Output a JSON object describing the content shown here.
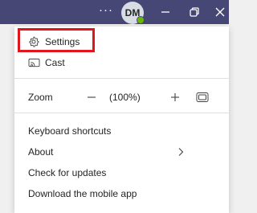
{
  "titlebar": {
    "more_label": "···",
    "avatar_initials": "DM",
    "presence_color": "#6bb700",
    "bar_color": "#464775"
  },
  "menu": {
    "settings_label": "Settings",
    "cast_label": "Cast",
    "zoom": {
      "label": "Zoom",
      "value": "(100%)"
    },
    "keyboard_shortcuts_label": "Keyboard shortcuts",
    "about_label": "About",
    "check_updates_label": "Check for updates",
    "download_mobile_label": "Download the mobile app"
  },
  "icons": {
    "settings": "gear-icon",
    "cast": "cast-icon",
    "zoom_out": "minus-icon",
    "zoom_in": "plus-icon",
    "zoom_fit": "fit-screen-icon",
    "about_submenu": "chevron-right-icon"
  },
  "highlight_color": "#e0161d"
}
